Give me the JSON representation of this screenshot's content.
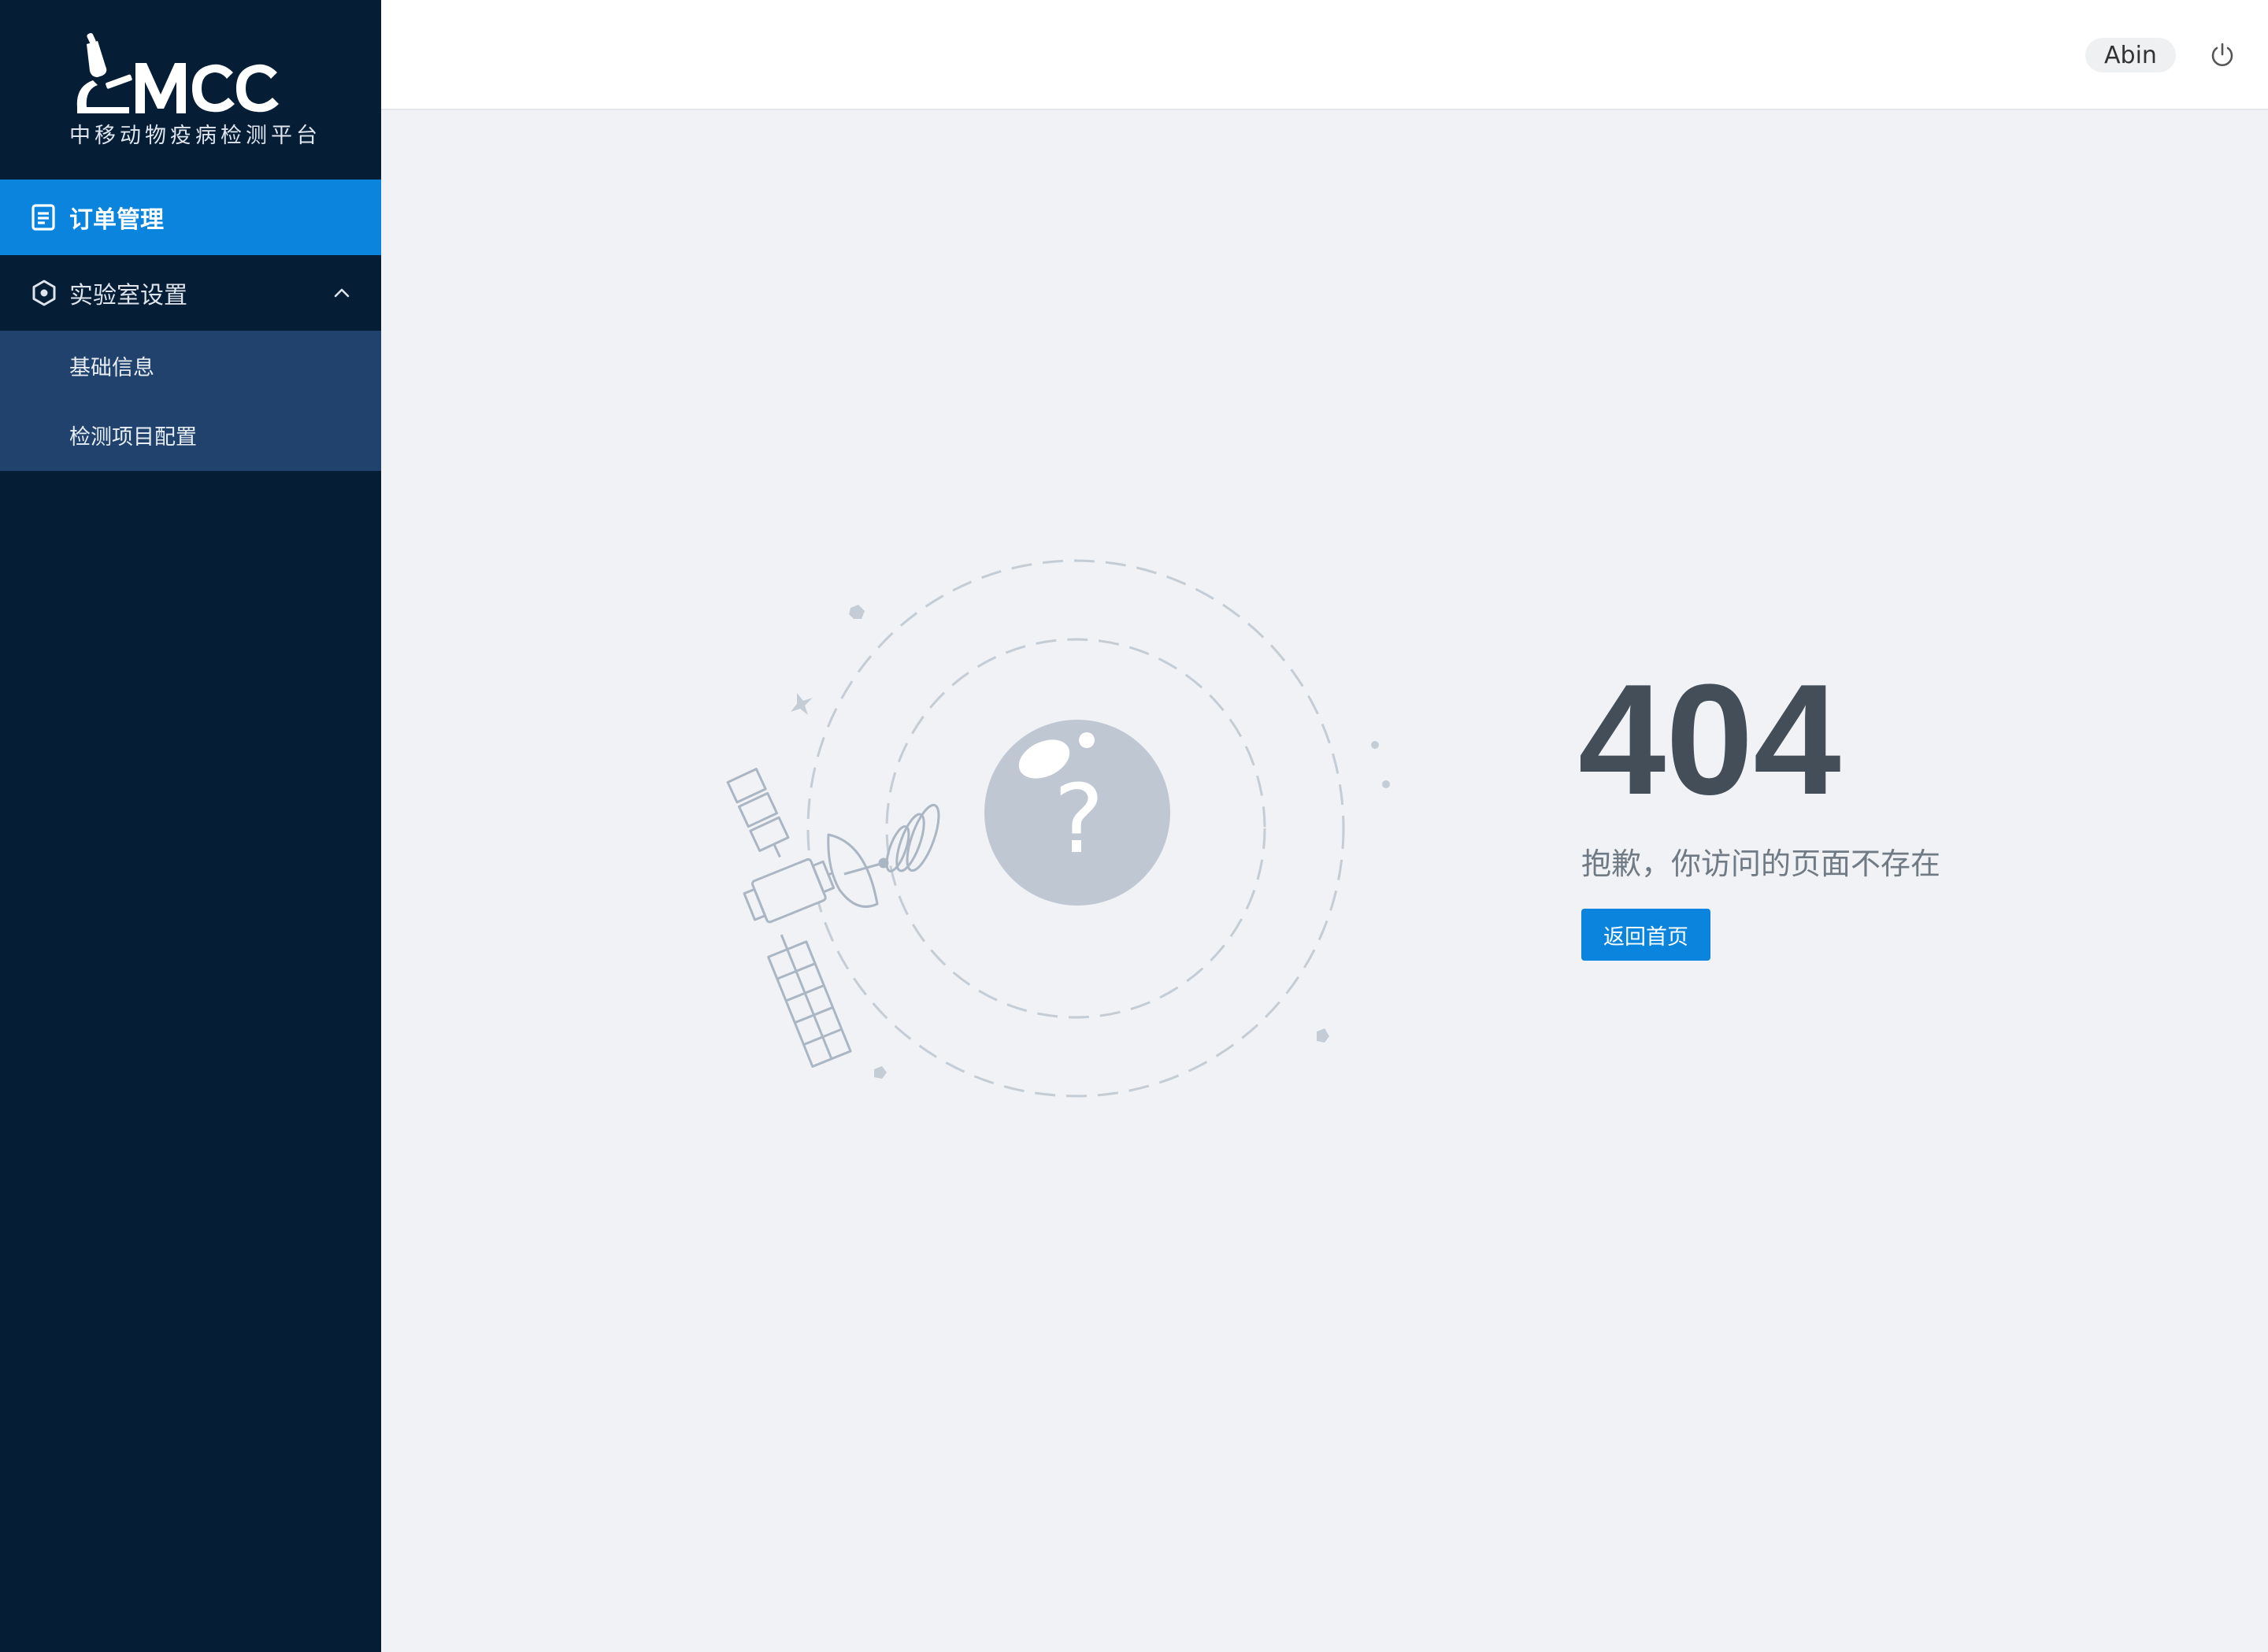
{
  "brand": {
    "logo_text": "MCC",
    "subtitle": "中移动物疫病检测平台"
  },
  "sidebar": {
    "items": [
      {
        "label": "订单管理",
        "icon": "document-list-icon",
        "active": true
      },
      {
        "label": "实验室设置",
        "icon": "hexagon-settings-icon",
        "expanded": true,
        "children": [
          {
            "label": "基础信息"
          },
          {
            "label": "检测项目配置"
          }
        ]
      }
    ]
  },
  "header": {
    "user_name": "Abin",
    "logout_icon": "power-icon"
  },
  "error": {
    "code": "404",
    "message": "抱歉，你访问的页面不存在",
    "home_button_label": "返回首页"
  },
  "colors": {
    "sidebar_bg": "#061d36",
    "active_item": "#0a84dc",
    "submenu_bg": "#20426c",
    "page_bg": "#f0f2f5",
    "error_code": "#434e59",
    "primary": "#0a84dc"
  }
}
